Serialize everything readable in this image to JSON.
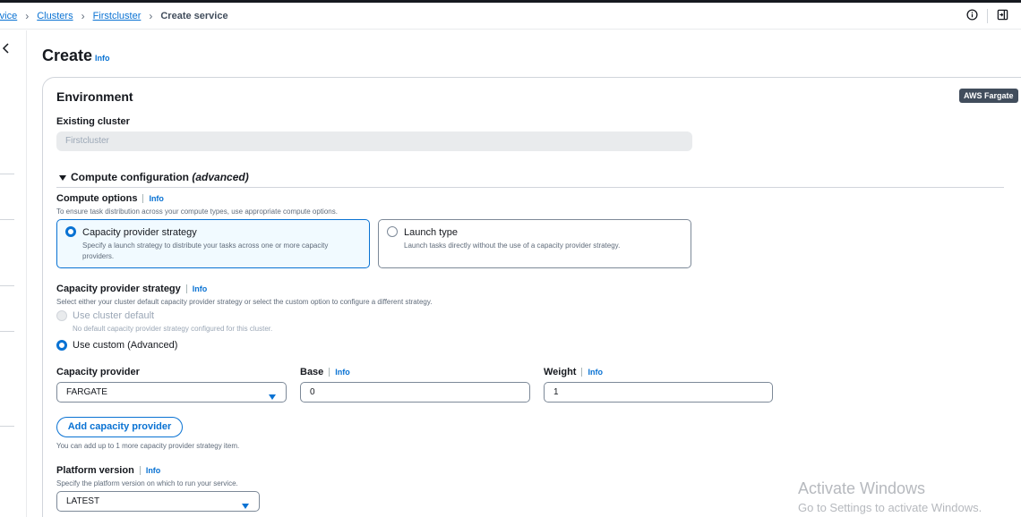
{
  "breadcrumb": {
    "items": [
      "rvice",
      "Clusters",
      "Firstcluster"
    ],
    "current": "Create service"
  },
  "icons": {
    "info": "info-circle-icon",
    "panel": "split-panel-icon",
    "rail": "chevron-left-icon",
    "caret": "caret-down-icon"
  },
  "page": {
    "title": "Create",
    "title_info": "Info"
  },
  "environment": {
    "title": "Environment",
    "badge": "AWS Fargate",
    "existing_cluster_label": "Existing cluster",
    "existing_cluster_value": "Firstcluster"
  },
  "compute": {
    "section_title": "Compute configuration",
    "section_title_suffix": "(advanced)",
    "options_label": "Compute options",
    "options_info": "Info",
    "options_desc": "To ensure task distribution across your compute types, use appropriate compute options.",
    "tiles": [
      {
        "title": "Capacity provider strategy",
        "desc": "Specify a launch strategy to distribute your tasks across one or more capacity providers."
      },
      {
        "title": "Launch type",
        "desc": "Launch tasks directly without the use of a capacity provider strategy."
      }
    ]
  },
  "strategy": {
    "label": "Capacity provider strategy",
    "info": "Info",
    "desc": "Select either your cluster default capacity provider strategy or select the custom option to configure a different strategy.",
    "option_default": "Use cluster default",
    "option_default_desc": "No default capacity provider strategy configured for this cluster.",
    "option_custom": "Use custom (Advanced)"
  },
  "provider_row": {
    "provider_label": "Capacity provider",
    "provider_value": "FARGATE",
    "base_label": "Base",
    "base_info": "Info",
    "base_value": "0",
    "weight_label": "Weight",
    "weight_info": "Info",
    "weight_value": "1"
  },
  "add_provider": {
    "button": "Add capacity provider",
    "hint": "You can add up to 1 more capacity provider strategy item."
  },
  "platform": {
    "label": "Platform version",
    "info": "Info",
    "desc": "Specify the platform version on which to run your service.",
    "value": "LATEST"
  },
  "watermark": {
    "title": "Activate Windows",
    "subtitle": "Go to Settings to activate Windows."
  },
  "colors": {
    "accent": "#0972d3",
    "text": "#16191f",
    "muted": "#5f6b7a",
    "badge_bg": "#414d5c",
    "selected_bg": "#f1faff"
  }
}
